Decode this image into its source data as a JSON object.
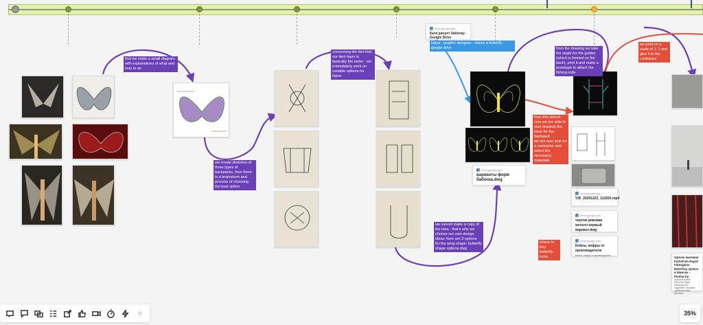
{
  "notes": {
    "n1": "first we make a small diagram with explanations of what and how to do",
    "n2": "we create sketches of three types of backpacks, then there is a brainstorm and process of choosing the best option",
    "n3": "concerning the fact that our item layer is basically the same - we immediately work on variable options for fabric",
    "n4": "we cannot make a copy of the idea - that's why we choose our own design ideas: here are 3 options for the wing shape: butterfly shape options.dwg",
    "n5": "katya - graphic designer - draws a butterfly - google drive",
    "n6": "from the drawing we take the angle for the guides (which is formed on the back), print it and make a prototype to attach the fishing rods",
    "n7": "from this sketch now we are able to start drawing the base for the backpack",
    "n8": "we are also look for a contractor and select the necessary materials",
    "n9": "we print on a scale of 1: 1 and give it to the contractor",
    "n10": "where to buy butterfly locks"
  },
  "cards": {
    "c1": {
      "source": "drive.google.com",
      "title": "Катя рисует бабочку - Google Drive"
    },
    "c2": {
      "source": "drive.google.com",
      "title": "варианты форм бабочка.dwg"
    },
    "c3": {
      "source": "drive.google.com",
      "title": "VID_20201222_112810.mp4"
    },
    "c4": {
      "source": "drive.google.com",
      "title": "чертеж рижзака металл первый вариант.dwg"
    },
    "c5": {
      "source": "drive.google.com",
      "title": "Кейсы, кофры от производителя",
      "subtitle": "Кейсы, кофры и производителя"
    },
    "c6": {
      "source": "",
      "title": "Удочка маховая Fish2Fish Rapid Fiberglass 6м/470гр купить в Минске - Peshar.by",
      "subtitle": "Удочка маховая Fish2Fish Rapid Fiberglass 6м — подробнее описание, характеристики, доставка"
    }
  },
  "toolbar": {
    "items": [
      "add-comment-icon",
      "comment-icon",
      "chat-icon",
      "list-icon",
      "share-icon",
      "like-icon",
      "video-icon",
      "timer-icon",
      "lightning-icon",
      "collapse-icon"
    ],
    "collapse_label": "«"
  },
  "zoom": "35%",
  "colors": {
    "purple": "#6a3fb8",
    "red": "#e34d3a",
    "blue": "#3a98e6",
    "timeline": "#e4f0b0"
  }
}
